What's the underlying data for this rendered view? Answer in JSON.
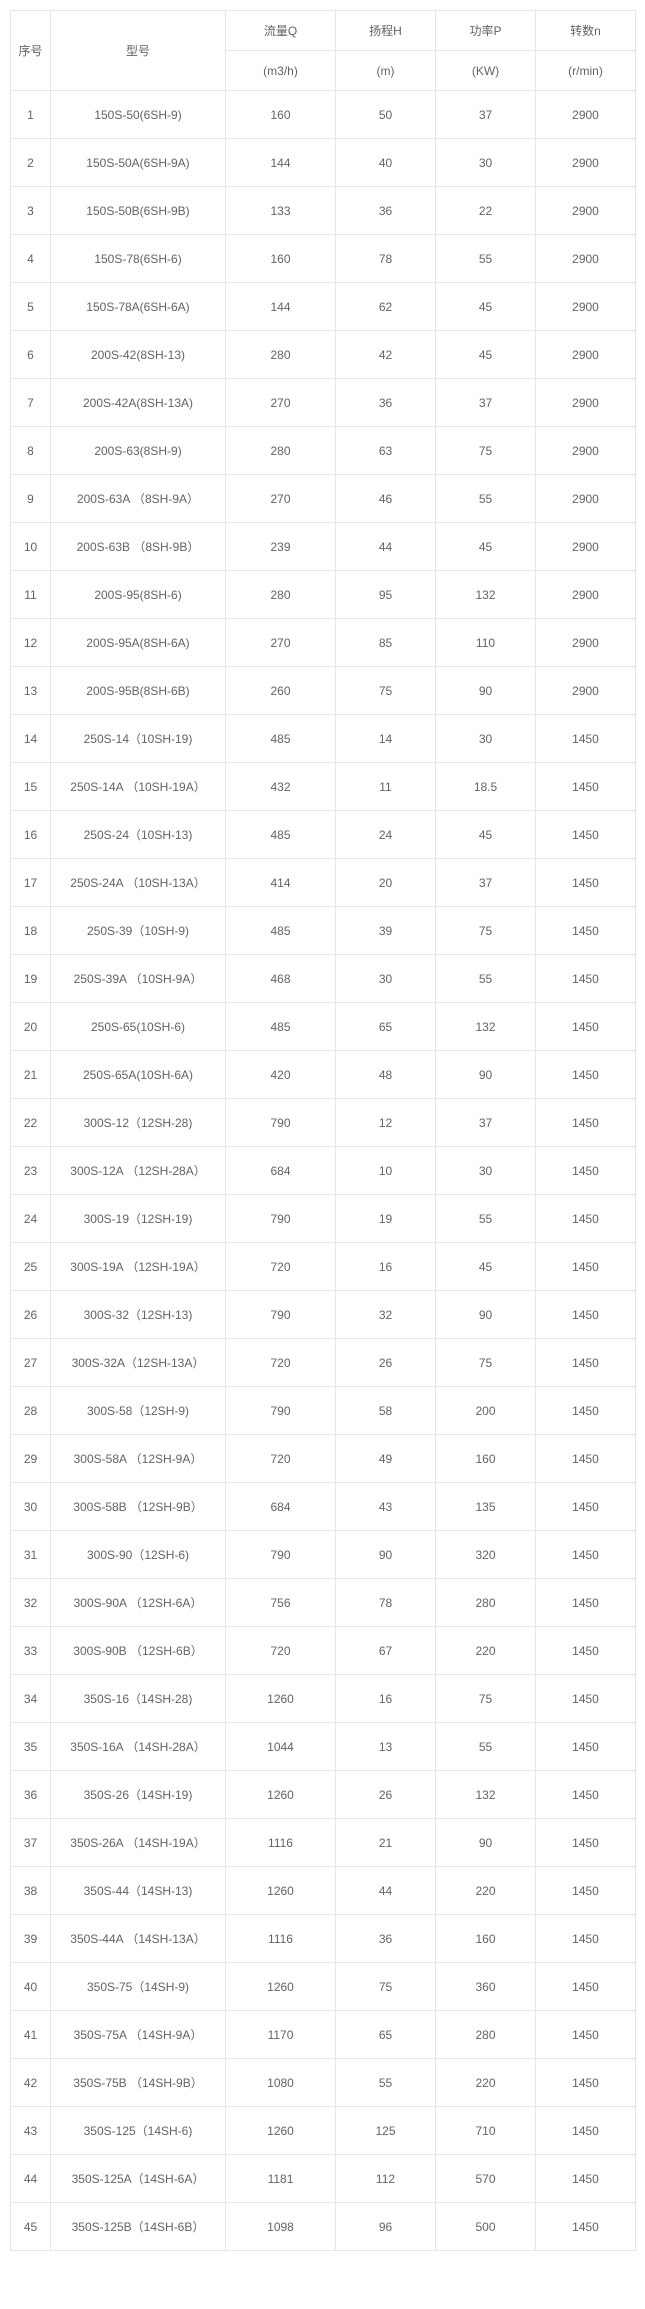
{
  "headers": {
    "seq": "序号",
    "model": "型号",
    "q_label": "流量Q",
    "q_unit": "(m3/h)",
    "h_label": "扬程H",
    "h_unit": "(m)",
    "p_label": "功率P",
    "p_unit": "(KW)",
    "n_label": "转数n",
    "n_unit": "(r/min)"
  },
  "rows": [
    {
      "seq": "1",
      "model": "150S-50(6SH-9)",
      "q": "160",
      "h": "50",
      "p": "37",
      "n": "2900"
    },
    {
      "seq": "2",
      "model": "150S-50A(6SH-9A)",
      "q": "144",
      "h": "40",
      "p": "30",
      "n": "2900"
    },
    {
      "seq": "3",
      "model": "150S-50B(6SH-9B)",
      "q": "133",
      "h": "36",
      "p": "22",
      "n": "2900"
    },
    {
      "seq": "4",
      "model": "150S-78(6SH-6)",
      "q": "160",
      "h": "78",
      "p": "55",
      "n": "2900"
    },
    {
      "seq": "5",
      "model": "150S-78A(6SH-6A)",
      "q": "144",
      "h": "62",
      "p": "45",
      "n": "2900"
    },
    {
      "seq": "6",
      "model": "200S-42(8SH-13)",
      "q": "280",
      "h": "42",
      "p": "45",
      "n": "2900"
    },
    {
      "seq": "7",
      "model": "200S-42A(8SH-13A)",
      "q": "270",
      "h": "36",
      "p": "37",
      "n": "2900"
    },
    {
      "seq": "8",
      "model": "200S-63(8SH-9)",
      "q": "280",
      "h": "63",
      "p": "75",
      "n": "2900"
    },
    {
      "seq": "9",
      "model": "200S-63A （8SH-9A）",
      "q": "270",
      "h": "46",
      "p": "55",
      "n": "2900"
    },
    {
      "seq": "10",
      "model": "200S-63B （8SH-9B）",
      "q": "239",
      "h": "44",
      "p": "45",
      "n": "2900"
    },
    {
      "seq": "11",
      "model": "200S-95(8SH-6)",
      "q": "280",
      "h": "95",
      "p": "132",
      "n": "2900"
    },
    {
      "seq": "12",
      "model": "200S-95A(8SH-6A)",
      "q": "270",
      "h": "85",
      "p": "110",
      "n": "2900"
    },
    {
      "seq": "13",
      "model": "200S-95B(8SH-6B)",
      "q": "260",
      "h": "75",
      "p": "90",
      "n": "2900"
    },
    {
      "seq": "14",
      "model": "250S-14（10SH-19)",
      "q": "485",
      "h": "14",
      "p": "30",
      "n": "1450"
    },
    {
      "seq": "15",
      "model": "250S-14A （10SH-19A）",
      "q": "432",
      "h": "11",
      "p": "18.5",
      "n": "1450"
    },
    {
      "seq": "16",
      "model": "250S-24（10SH-13)",
      "q": "485",
      "h": "24",
      "p": "45",
      "n": "1450"
    },
    {
      "seq": "17",
      "model": "250S-24A （10SH-13A）",
      "q": "414",
      "h": "20",
      "p": "37",
      "n": "1450"
    },
    {
      "seq": "18",
      "model": "250S-39（10SH-9)",
      "q": "485",
      "h": "39",
      "p": "75",
      "n": "1450"
    },
    {
      "seq": "19",
      "model": "250S-39A （10SH-9A）",
      "q": "468",
      "h": "30",
      "p": "55",
      "n": "1450"
    },
    {
      "seq": "20",
      "model": "250S-65(10SH-6)",
      "q": "485",
      "h": "65",
      "p": "132",
      "n": "1450"
    },
    {
      "seq": "21",
      "model": "250S-65A(10SH-6A)",
      "q": "420",
      "h": "48",
      "p": "90",
      "n": "1450"
    },
    {
      "seq": "22",
      "model": "300S-12（12SH-28)",
      "q": "790",
      "h": "12",
      "p": "37",
      "n": "1450"
    },
    {
      "seq": "23",
      "model": "300S-12A （12SH-28A）",
      "q": "684",
      "h": "10",
      "p": "30",
      "n": "1450"
    },
    {
      "seq": "24",
      "model": "300S-19（12SH-19)",
      "q": "790",
      "h": "19",
      "p": "55",
      "n": "1450"
    },
    {
      "seq": "25",
      "model": "300S-19A （12SH-19A）",
      "q": "720",
      "h": "16",
      "p": "45",
      "n": "1450"
    },
    {
      "seq": "26",
      "model": "300S-32（12SH-13)",
      "q": "790",
      "h": "32",
      "p": "90",
      "n": "1450"
    },
    {
      "seq": "27",
      "model": "300S-32A（12SH-13A）",
      "q": "720",
      "h": "26",
      "p": "75",
      "n": "1450"
    },
    {
      "seq": "28",
      "model": "300S-58（12SH-9)",
      "q": "790",
      "h": "58",
      "p": "200",
      "n": "1450"
    },
    {
      "seq": "29",
      "model": "300S-58A （12SH-9A）",
      "q": "720",
      "h": "49",
      "p": "160",
      "n": "1450"
    },
    {
      "seq": "30",
      "model": "300S-58B （12SH-9B）",
      "q": "684",
      "h": "43",
      "p": "135",
      "n": "1450"
    },
    {
      "seq": "31",
      "model": "300S-90（12SH-6)",
      "q": "790",
      "h": "90",
      "p": "320",
      "n": "1450"
    },
    {
      "seq": "32",
      "model": "300S-90A （12SH-6A）",
      "q": "756",
      "h": "78",
      "p": "280",
      "n": "1450"
    },
    {
      "seq": "33",
      "model": "300S-90B （12SH-6B）",
      "q": "720",
      "h": "67",
      "p": "220",
      "n": "1450"
    },
    {
      "seq": "34",
      "model": "350S-16（14SH-28)",
      "q": "1260",
      "h": "16",
      "p": "75",
      "n": "1450"
    },
    {
      "seq": "35",
      "model": "350S-16A （14SH-28A）",
      "q": "1044",
      "h": "13",
      "p": "55",
      "n": "1450"
    },
    {
      "seq": "36",
      "model": "350S-26（14SH-19)",
      "q": "1260",
      "h": "26",
      "p": "132",
      "n": "1450"
    },
    {
      "seq": "37",
      "model": "350S-26A （14SH-19A）",
      "q": "1116",
      "h": "21",
      "p": "90",
      "n": "1450"
    },
    {
      "seq": "38",
      "model": "350S-44（14SH-13)",
      "q": "1260",
      "h": "44",
      "p": "220",
      "n": "1450"
    },
    {
      "seq": "39",
      "model": "350S-44A （14SH-13A）",
      "q": "1116",
      "h": "36",
      "p": "160",
      "n": "1450"
    },
    {
      "seq": "40",
      "model": "350S-75（14SH-9)",
      "q": "1260",
      "h": "75",
      "p": "360",
      "n": "1450"
    },
    {
      "seq": "41",
      "model": "350S-75A （14SH-9A）",
      "q": "1170",
      "h": "65",
      "p": "280",
      "n": "1450"
    },
    {
      "seq": "42",
      "model": "350S-75B （14SH-9B）",
      "q": "1080",
      "h": "55",
      "p": "220",
      "n": "1450"
    },
    {
      "seq": "43",
      "model": "350S-125（14SH-6)",
      "q": "1260",
      "h": "125",
      "p": "710",
      "n": "1450"
    },
    {
      "seq": "44",
      "model": "350S-125A（14SH-6A）",
      "q": "1181",
      "h": "112",
      "p": "570",
      "n": "1450"
    },
    {
      "seq": "45",
      "model": "350S-125B（14SH-6B）",
      "q": "1098",
      "h": "96",
      "p": "500",
      "n": "1450"
    }
  ]
}
